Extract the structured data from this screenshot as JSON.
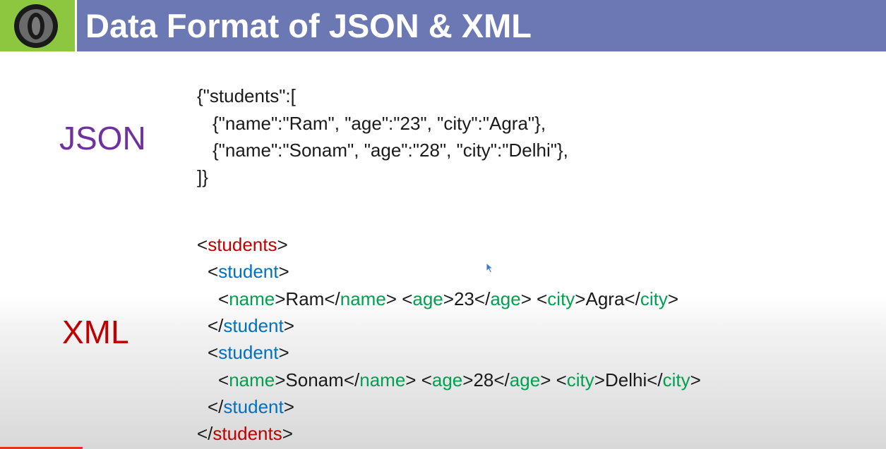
{
  "header": {
    "title": "Data Format of JSON & XML",
    "logo_icon": "json-logo-icon"
  },
  "labels": {
    "json": "JSON",
    "xml": "XML"
  },
  "json_code": {
    "l1": "{\"students\":[",
    "l2": "{\"name\":\"Ram\", \"age\":\"23\", \"city\":\"Agra\"},",
    "l3": "{\"name\":\"Sonam\", \"age\":\"28\", \"city\":\"Delhi\"},",
    "l4": "]}"
  },
  "xml_code": {
    "root_tag": "students",
    "item_tag": "student",
    "name_tag": "name",
    "age_tag": "age",
    "city_tag": "city",
    "records": [
      {
        "name": "Ram",
        "age": "23",
        "city": "Agra"
      },
      {
        "name": "Sonam",
        "age": "28",
        "city": "Delhi"
      }
    ]
  },
  "colors": {
    "header_bar": "#6b78b4",
    "logo_bg": "#8dc63f",
    "json_label": "#7030a0",
    "xml_label": "#c00000",
    "root_tag": "#c00000",
    "item_tag": "#0070c0",
    "field_tag": "#00a050"
  }
}
